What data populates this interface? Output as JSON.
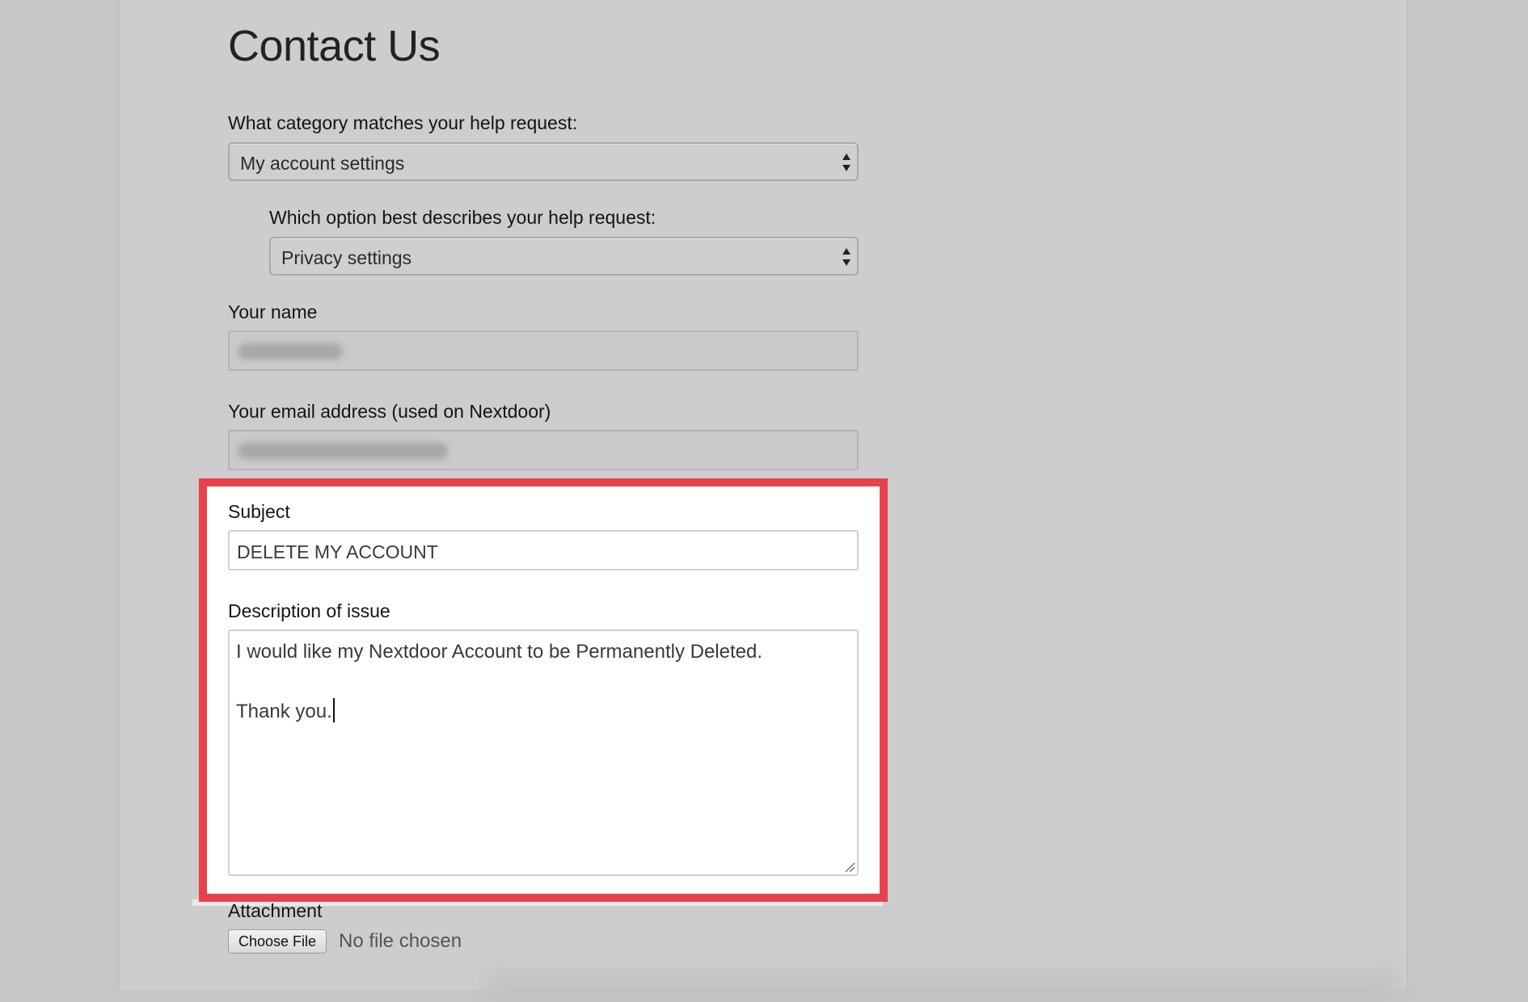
{
  "page_title": "Contact Us",
  "category": {
    "label": "What category matches your help request:",
    "selected": "My account settings"
  },
  "option": {
    "label": "Which option best describes your help request:",
    "selected": "Privacy settings"
  },
  "name_field": {
    "label": "Your name"
  },
  "email_field": {
    "label": "Your email address (used on Nextdoor)"
  },
  "subject": {
    "label": "Subject",
    "value": "DELETE MY ACCOUNT"
  },
  "description": {
    "label": "Description of issue",
    "line1": "I would like my Nextdoor Account to be Permanently Deleted.",
    "line2": "Thank you."
  },
  "attachment": {
    "label": "Attachment",
    "button_label": "Choose File",
    "status": "No file chosen"
  },
  "colors": {
    "highlight_border": "#e8414b",
    "overlay_gray": "#cdcdcd"
  }
}
